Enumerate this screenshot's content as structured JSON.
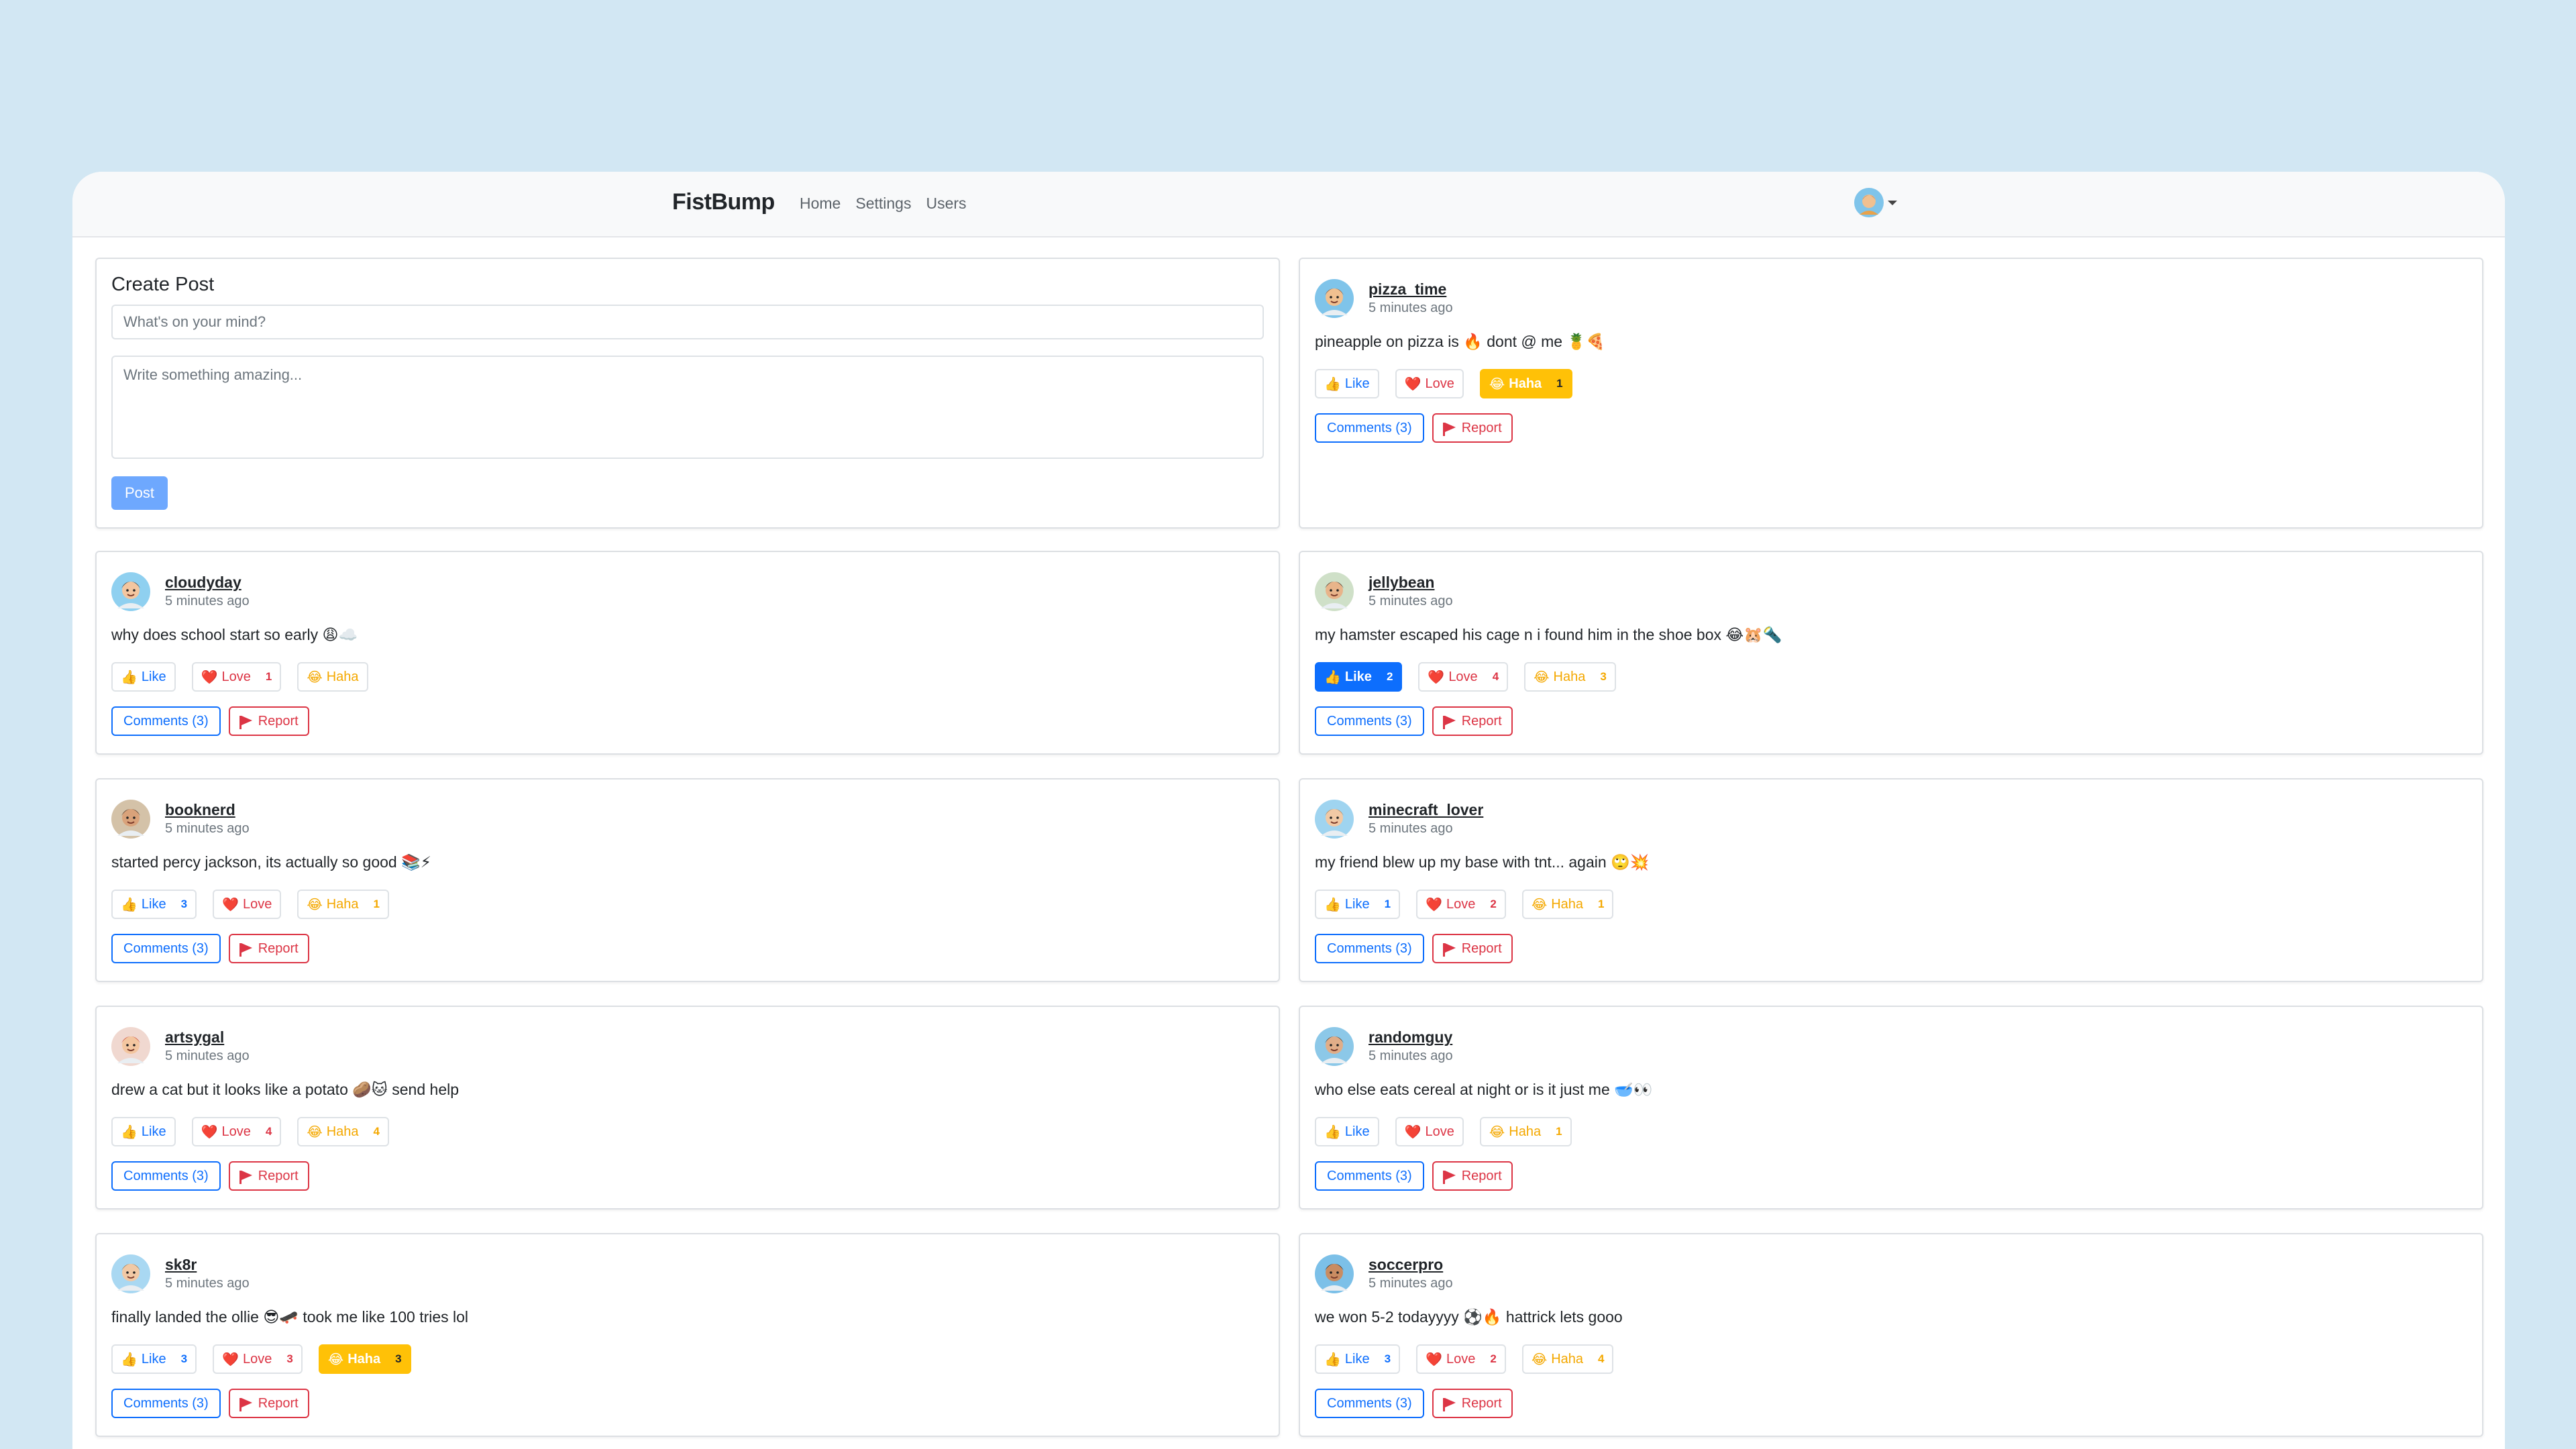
{
  "app": {
    "brand": "FistBump"
  },
  "nav": {
    "links": [
      "Home",
      "Settings",
      "Users"
    ]
  },
  "create_post": {
    "title": "Create Post",
    "title_placeholder": "What's on your mind?",
    "body_placeholder": "Write something amazing...",
    "button": "Post"
  },
  "labels": {
    "like": "Like",
    "love": "Love",
    "haha": "Haha",
    "report": "Report"
  },
  "colors": {
    "primary": "#0d6efd",
    "danger": "#dc3545",
    "warning": "#ffc107",
    "background": "#d2e7f3"
  },
  "posts": [
    {
      "user": "pizza_time",
      "time": "5 minutes ago",
      "content": "pineapple on pizza is 🔥 dont @ me 🍍🍕",
      "like": "",
      "love": "",
      "haha": "1",
      "active": "haha",
      "comments": "Comments (3)",
      "avatar": {
        "skin": "#f0c090",
        "hair": "#8a4a2a",
        "bg": "#7fc4ea"
      }
    },
    {
      "user": "cloudyday",
      "time": "5 minutes ago",
      "content": "why does school start so early 😩☁️",
      "like": "",
      "love": "1",
      "haha": "",
      "active": "",
      "comments": "Comments (3)",
      "avatar": {
        "skin": "#f3c6a0",
        "hair": "#2a2a2a",
        "bg": "#8fd0f0"
      }
    },
    {
      "user": "jellybean",
      "time": "5 minutes ago",
      "content": "my hamster escaped his cage n i found him in the shoe box 😂🐹🔦",
      "like": "2",
      "love": "4",
      "haha": "3",
      "active": "like",
      "comments": "Comments (3)",
      "avatar": {
        "skin": "#e8b48a",
        "hair": "#2b1a12",
        "bg": "#cfe0c8"
      }
    },
    {
      "user": "booknerd",
      "time": "5 minutes ago",
      "content": "started percy jackson, its actually so good 📚⚡",
      "like": "3",
      "love": "",
      "haha": "1",
      "active": "",
      "comments": "Comments (3)",
      "avatar": {
        "skin": "#d9a27a",
        "hair": "#3a2418",
        "bg": "#d4c2a8"
      }
    },
    {
      "user": "minecraft_lover",
      "time": "5 minutes ago",
      "content": "my friend blew up my base with tnt... again 🙄💥",
      "like": "1",
      "love": "2",
      "haha": "1",
      "active": "",
      "comments": "Comments (3)",
      "avatar": {
        "skin": "#f1c9a5",
        "hair": "#b07a48",
        "bg": "#9fd4f0"
      }
    },
    {
      "user": "artsygal",
      "time": "5 minutes ago",
      "content": "drew a cat but it looks like a potato 🥔🐱 send help",
      "like": "",
      "love": "4",
      "haha": "4",
      "active": "",
      "comments": "Comments (3)",
      "avatar": {
        "skin": "#f3c6a0",
        "hair": "#c83a2a",
        "bg": "#f0d8d0"
      }
    },
    {
      "user": "randomguy",
      "time": "5 minutes ago",
      "content": "who else eats cereal at night or is it just me 🥣👀",
      "like": "",
      "love": "",
      "haha": "1",
      "active": "",
      "comments": "Comments (3)",
      "avatar": {
        "skin": "#e0ad88",
        "hair": "#3a2a20",
        "bg": "#8cc8e8"
      }
    },
    {
      "user": "sk8r",
      "time": "5 minutes ago",
      "content": "finally landed the ollie 😎🛹 took me like 100 tries lol",
      "like": "3",
      "love": "3",
      "haha": "3",
      "active": "haha",
      "comments": "Comments (3)",
      "avatar": {
        "skin": "#f1c9a5",
        "hair": "#9a6a3a",
        "bg": "#a9d8f2"
      }
    },
    {
      "user": "soccerpro",
      "time": "5 minutes ago",
      "content": "we won 5-2 todayyyy ⚽🔥 hattrick lets gooo",
      "like": "3",
      "love": "2",
      "haha": "4",
      "active": "",
      "comments": "Comments (3)",
      "avatar": {
        "skin": "#c98c62",
        "hair": "#1e1410",
        "bg": "#7cc0e8"
      }
    }
  ]
}
